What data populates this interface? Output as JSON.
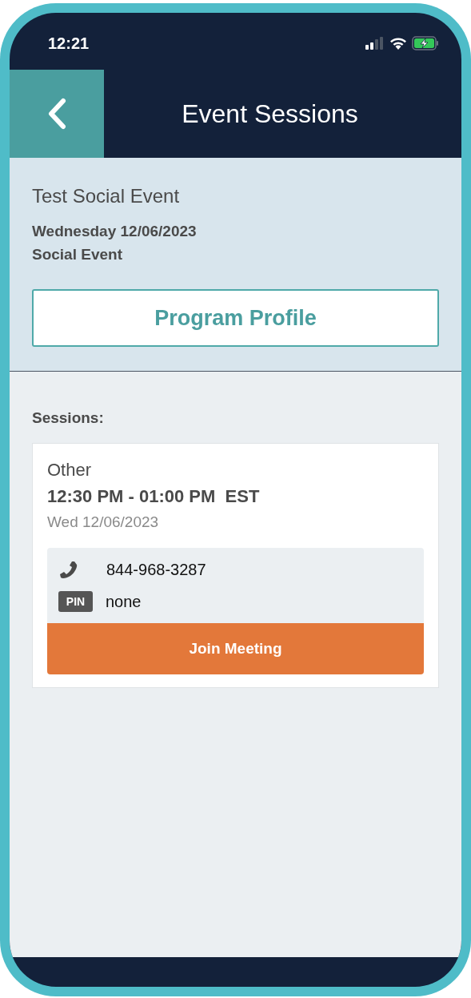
{
  "status_bar": {
    "time": "12:21"
  },
  "header": {
    "title": "Event Sessions"
  },
  "event": {
    "title": "Test Social Event",
    "date": "Wednesday 12/06/2023",
    "type": "Social Event",
    "profile_button": "Program Profile"
  },
  "sessions_label": "Sessions:",
  "sessions": [
    {
      "name": "Other",
      "time": "12:30 PM - 01:00 PM  EST",
      "date": "Wed 12/06/2023",
      "phone": "844-968-3287",
      "pin_label": "PIN",
      "pin": "none",
      "join_button": "Join Meeting"
    }
  ]
}
